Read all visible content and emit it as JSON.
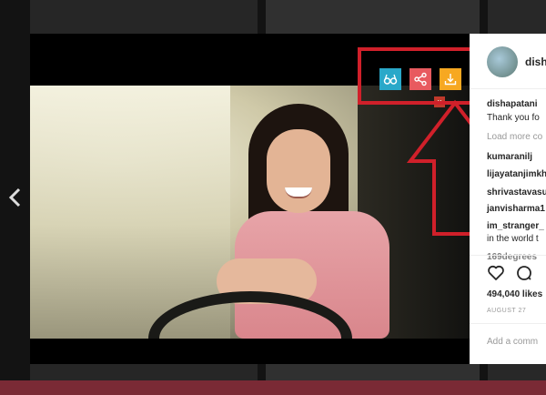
{
  "toolbar": {
    "view_icon": "glasses-icon",
    "share_icon": "share-icon",
    "download_icon": "download-icon",
    "close_label": "x",
    "colors": {
      "view": "#2aa8c9",
      "share": "#e85a5f",
      "download": "#f7a821",
      "highlight": "#d0202a"
    }
  },
  "post": {
    "username": "dishapatani",
    "caption_author": "dishapatani",
    "caption_text": "Thank you fo",
    "load_more": "Load more co",
    "comments": [
      {
        "user": "kumaranilj"
      },
      {
        "user": "lijayatanjimkh"
      },
      {
        "user": "shrivastavasu"
      },
      {
        "user": "janvisharma1"
      },
      {
        "user": "im_stranger_",
        "text": "in the world t"
      },
      {
        "user": "169degrees"
      }
    ],
    "likes": "494,040 likes",
    "date": "AUGUST 27",
    "add_comment_placeholder": "Add a comm"
  }
}
